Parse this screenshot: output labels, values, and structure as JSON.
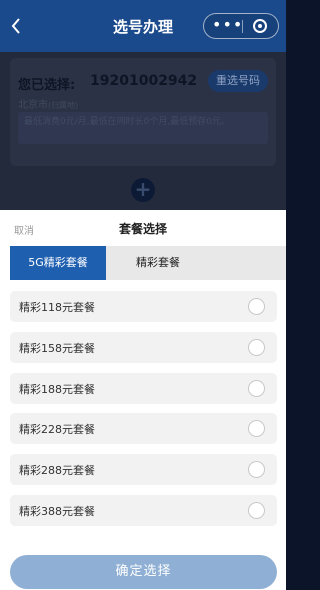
{
  "header": {
    "title": "选号办理",
    "back_icon": "chevron-left-icon",
    "more_icon": "more-dots-icon",
    "close_icon": "target-close-icon"
  },
  "background": {
    "selected_label": "您已选择:",
    "selected_number": "19201002942",
    "reselect_label": "重选号码",
    "city": "北京市",
    "city_note": "(归属地)",
    "notice": "最低消费0元/月,最低在网时长0个月,最低预存0元。",
    "add_icon": "plus-icon"
  },
  "sheet": {
    "cancel_label": "取消",
    "title": "套餐选择",
    "tabs": [
      {
        "label": "5G精彩套餐",
        "active": true
      },
      {
        "label": "精彩套餐",
        "active": false
      }
    ],
    "options": [
      {
        "label": "精彩118元套餐",
        "selected": false
      },
      {
        "label": "精彩158元套餐",
        "selected": false
      },
      {
        "label": "精彩188元套餐",
        "selected": false
      },
      {
        "label": "精彩228元套餐",
        "selected": false
      },
      {
        "label": "精彩288元套餐",
        "selected": false
      },
      {
        "label": "精彩388元套餐",
        "selected": false
      }
    ],
    "confirm_label": "确定选择"
  },
  "colors": {
    "header_bg": "#1a4a8c",
    "tab_active_bg": "#1f5fb0",
    "confirm_bg": "#8fb0d4"
  }
}
